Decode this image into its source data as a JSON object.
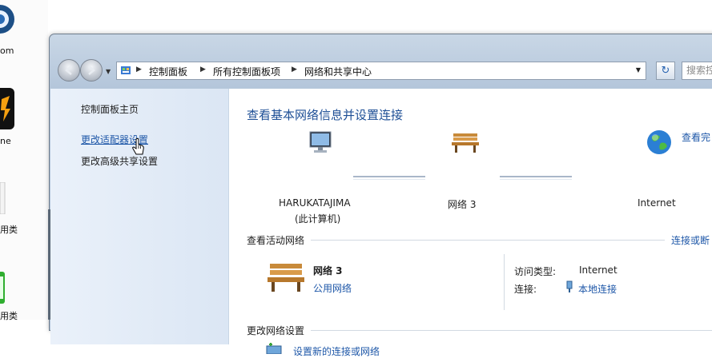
{
  "desktop": {
    "icons": [
      {
        "name": "app-blue-icon",
        "label": "om"
      },
      {
        "name": "app-orange-icon",
        "label": "ne"
      },
      {
        "name": "app-doc-icon",
        "label": "用类"
      },
      {
        "name": "app-green-icon",
        "label": "用类"
      }
    ]
  },
  "address_bar": {
    "crumbs": [
      "控制面板",
      "所有控制面板项",
      "网络和共享中心"
    ],
    "search_placeholder": "搜索控"
  },
  "left_pane": {
    "links": [
      {
        "label": "控制面板主页"
      },
      {
        "label": "更改适配器设置"
      },
      {
        "label": "更改高级共享设置"
      }
    ]
  },
  "main": {
    "title": "查看基本网络信息并设置连接",
    "see_full_map": "查看完",
    "map": {
      "computer_name": "HARUKATAJIMA",
      "computer_sub": "(此计算机)",
      "network": "网络  3",
      "internet": "Internet"
    },
    "active_networks": {
      "heading": "查看活动网络",
      "connect_link": "连接或断",
      "network_name": "网络  3",
      "network_category": "公用网络",
      "access_type_label": "访问类型:",
      "access_type_value": "Internet",
      "connections_label": "连接:",
      "connections_value": "本地连接"
    },
    "change_settings": {
      "heading": "更改网络设置",
      "new_connection": "设置新的连接或网络"
    }
  }
}
